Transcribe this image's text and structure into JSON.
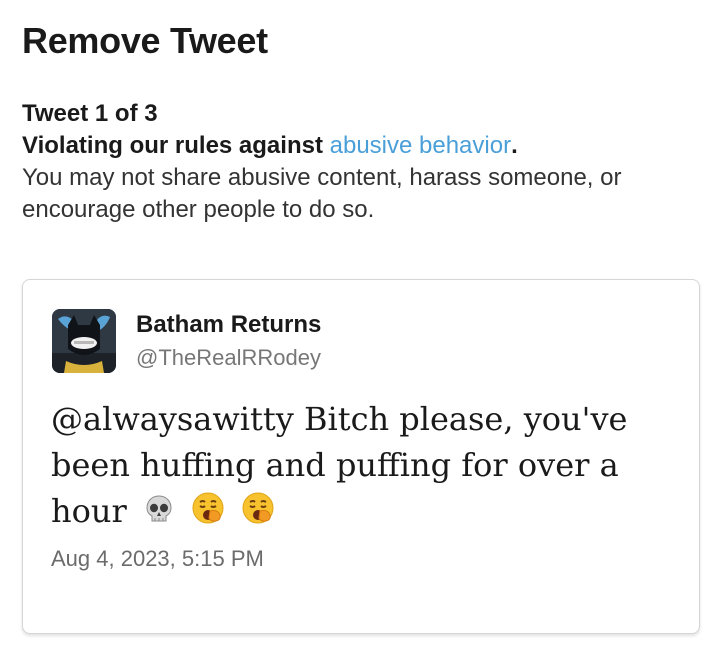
{
  "header": {
    "title": "Remove Tweet"
  },
  "notice": {
    "counter": "Tweet 1 of 3",
    "rule_prefix": "Violating our rules against ",
    "rule_link": "abusive behavior",
    "rule_suffix": ".",
    "explanation": "You may not share abusive content, harass someone, or encourage other people to do so."
  },
  "tweet": {
    "author_name": "Batham Returns",
    "author_handle": "@TheRealRRodey",
    "text": "@alwaysawitty Bitch please, you've been huffing and puffing for over a hour",
    "emojis": [
      "skull-emoji",
      "yawning-face-emoji",
      "yawning-face-emoji"
    ],
    "timestamp": "Aug 4, 2023, 5:15 PM"
  },
  "colors": {
    "link": "#4a9fd8",
    "border": "#d6d6d6",
    "muted": "#777777"
  }
}
